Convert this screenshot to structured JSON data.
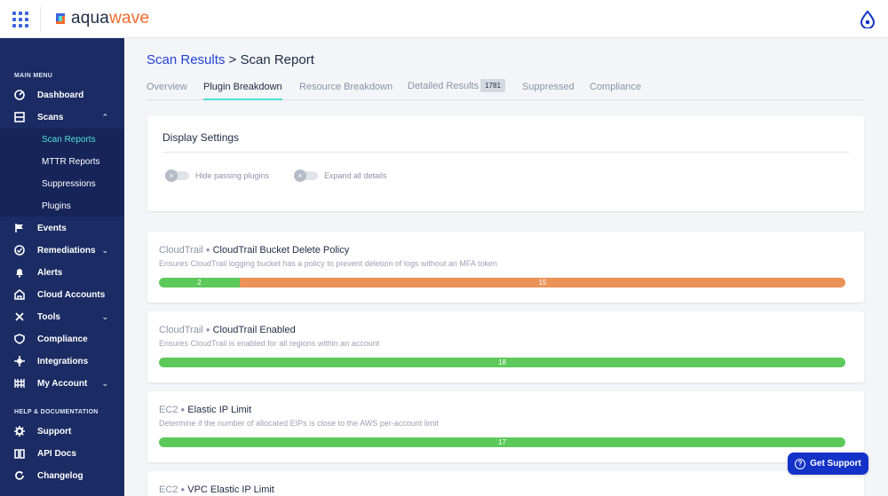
{
  "app": {
    "logo_prefix": "aqua",
    "logo_suffix": "wave"
  },
  "sidebar": {
    "main_heading": "MAIN MENU",
    "items": [
      {
        "label": "Dashboard",
        "icon": "dashboard-icon"
      },
      {
        "label": "Scans",
        "icon": "scans-icon",
        "chevron": "⌃"
      },
      {
        "label": "Events",
        "icon": "flag-icon"
      },
      {
        "label": "Remediations",
        "icon": "remediations-icon",
        "chevron": "⌄"
      },
      {
        "label": "Alerts",
        "icon": "bell-icon"
      },
      {
        "label": "Cloud Accounts",
        "icon": "cloud-accounts-icon"
      },
      {
        "label": "Tools",
        "icon": "tools-icon",
        "chevron": "⌄"
      },
      {
        "label": "Compliance",
        "icon": "shield-icon"
      },
      {
        "label": "Integrations",
        "icon": "integrations-icon"
      },
      {
        "label": "My Account",
        "icon": "account-icon",
        "chevron": "⌄"
      }
    ],
    "scans_sub": [
      "Scan Reports",
      "MTTR Reports",
      "Suppressions",
      "Plugins"
    ],
    "help_heading": "HELP & DOCUMENTATION",
    "help_items": [
      {
        "label": "Support",
        "icon": "gear-icon"
      },
      {
        "label": "API Docs",
        "icon": "book-icon"
      },
      {
        "label": "Changelog",
        "icon": "refresh-icon"
      }
    ]
  },
  "breadcrumb": {
    "parent": "Scan Results",
    "separator": ">",
    "current": "Scan Report"
  },
  "tabs": [
    {
      "label": "Overview"
    },
    {
      "label": "Plugin Breakdown"
    },
    {
      "label": "Resource Breakdown"
    },
    {
      "label": "Detailed Results",
      "badge": "1781"
    },
    {
      "label": "Suppressed"
    },
    {
      "label": "Compliance"
    }
  ],
  "display_settings": {
    "title": "Display Settings",
    "toggles": [
      {
        "label": "Hide passing plugins",
        "state": "off"
      },
      {
        "label": "Expand all details",
        "state": "off"
      }
    ]
  },
  "colors": {
    "pass": "#5cc95a",
    "fail": "#eb9258",
    "accent": "#4fe0d3",
    "primary": "#1432c8",
    "sidebar": "#1b2b63"
  },
  "plugins": [
    {
      "service": "CloudTrail",
      "name": "CloudTrail Bucket Delete Policy",
      "description": "Ensures CloudTrail logging bucket has a policy to prevent deletion of logs without an MFA token",
      "pass": 2,
      "fail": 15
    },
    {
      "service": "CloudTrail",
      "name": "CloudTrail Enabled",
      "description": "Ensures CloudTrail is enabled for all regions within an account",
      "pass": 18,
      "fail": 0
    },
    {
      "service": "EC2",
      "name": "Elastic IP Limit",
      "description": "Determine if the number of allocated EIPs is close to the AWS per-account limit",
      "pass": 17,
      "fail": 0
    },
    {
      "service": "EC2",
      "name": "VPC Elastic IP Limit",
      "description": "",
      "pass": 0,
      "fail": 0
    }
  ],
  "support_button": {
    "label": "Get Support"
  }
}
